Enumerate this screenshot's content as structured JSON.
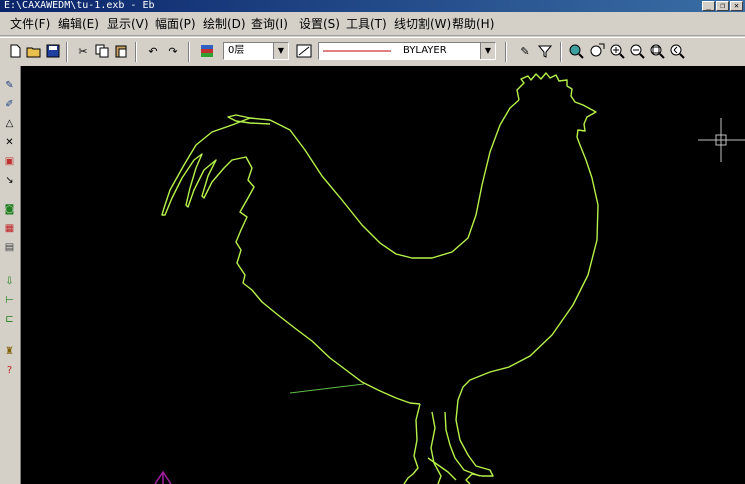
{
  "window": {
    "title": "E:\\CAXAWEDM\\tu-1.exb - Eb"
  },
  "menu": [
    {
      "label": "文件(F)"
    },
    {
      "label": "编辑(E)"
    },
    {
      "label": "显示(V)"
    },
    {
      "label": "幅面(P)"
    },
    {
      "label": "绘制(D)"
    },
    {
      "label": "查询(I)"
    },
    {
      "label": "设置(S)"
    },
    {
      "label": "工具(T)"
    },
    {
      "label": "线切割(W)"
    },
    {
      "label": "帮助(H)"
    }
  ],
  "toolbar": {
    "layer_value": "0层",
    "linetype_value": "BYLAYER"
  },
  "icons": {
    "new": "new-file-icon",
    "open": "open-folder-icon",
    "save": "save-disk-icon",
    "cut": "scissors-icon",
    "copy": "copy-icon",
    "paste": "paste-icon",
    "undo": "undo-icon",
    "redo": "redo-icon",
    "layer": "layer-stack-icon",
    "linetype": "linetype-icon",
    "pen": "pen-icon",
    "filter": "filter-icon",
    "zoom_window": "zoom-window-icon",
    "zoom_pan": "pan-icon",
    "zoom_in": "zoom-in-icon",
    "zoom_out": "zoom-out-icon",
    "zoom_all": "zoom-all-icon"
  },
  "colors": {
    "drawing_line": "#b6f24a",
    "canvas_bg": "#000000",
    "linetype_sample": "#c00000"
  }
}
